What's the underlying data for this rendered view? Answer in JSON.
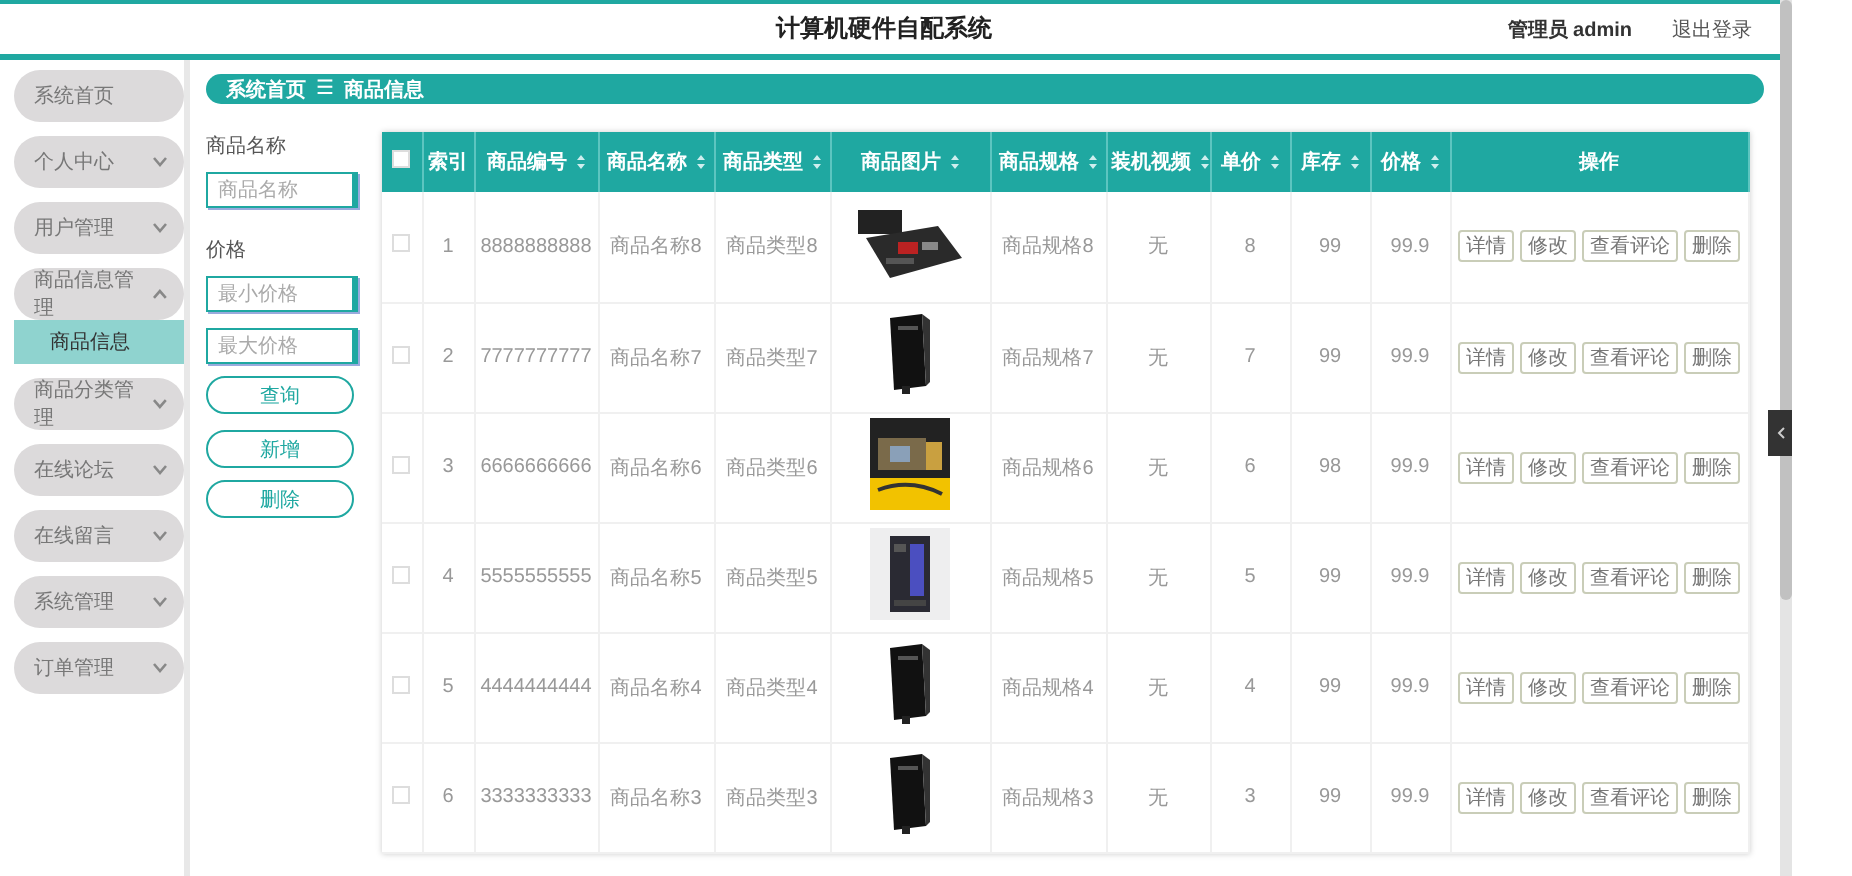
{
  "header": {
    "title": "计算机硬件自配系统",
    "user": "管理员 admin",
    "logout": "退出登录"
  },
  "sidebar": {
    "items": [
      {
        "label": "系统首页",
        "kind": "link"
      },
      {
        "label": "个人中心",
        "kind": "menu",
        "expanded": false
      },
      {
        "label": "用户管理",
        "kind": "menu",
        "expanded": false
      },
      {
        "label": "商品信息管理",
        "kind": "menu",
        "expanded": true,
        "children": [
          {
            "label": "商品信息",
            "selected": true
          }
        ]
      },
      {
        "label": "商品分类管理",
        "kind": "menu",
        "expanded": false
      },
      {
        "label": "在线论坛",
        "kind": "menu",
        "expanded": false
      },
      {
        "label": "在线留言",
        "kind": "menu",
        "expanded": false
      },
      {
        "label": "系统管理",
        "kind": "menu",
        "expanded": false
      },
      {
        "label": "订单管理",
        "kind": "menu",
        "expanded": false
      }
    ]
  },
  "breadcrumb": {
    "items": [
      "系统首页",
      "商品信息"
    ],
    "separator": "☰"
  },
  "search": {
    "name_label": "商品名称",
    "name_placeholder": "商品名称",
    "price_label": "价格",
    "min_placeholder": "最小价格",
    "max_placeholder": "最大价格",
    "buttons": [
      "查询",
      "新增",
      "删除"
    ]
  },
  "table": {
    "select_all": {
      "checked": false
    },
    "columns": [
      {
        "label": "索引",
        "sortable": false
      },
      {
        "label": "商品编号",
        "sortable": true
      },
      {
        "label": "商品名称",
        "sortable": true
      },
      {
        "label": "商品类型",
        "sortable": true
      },
      {
        "label": "商品图片",
        "sortable": true
      },
      {
        "label": "商品规格",
        "sortable": true
      },
      {
        "label": "装机视频",
        "sortable": true
      },
      {
        "label": "单价",
        "sortable": true
      },
      {
        "label": "库存",
        "sortable": true
      },
      {
        "label": "价格",
        "sortable": true
      },
      {
        "label": "操作",
        "sortable": false
      }
    ],
    "rows": [
      {
        "checked": false,
        "cells": [
          "1",
          "8888888888",
          "商品名称8",
          "商品类型8",
          "",
          "商品规格8",
          "无",
          "8",
          "99",
          "99.9"
        ],
        "actions": [
          "详情",
          "修改",
          "查看评论",
          "删除"
        ]
      },
      {
        "checked": false,
        "cells": [
          "2",
          "7777777777",
          "商品名称7",
          "商品类型7",
          "",
          "商品规格7",
          "无",
          "7",
          "99",
          "99.9"
        ],
        "actions": [
          "详情",
          "修改",
          "查看评论",
          "删除"
        ]
      },
      {
        "checked": false,
        "cells": [
          "3",
          "6666666666",
          "商品名称6",
          "商品类型6",
          "",
          "商品规格6",
          "无",
          "6",
          "98",
          "99.9"
        ],
        "actions": [
          "详情",
          "修改",
          "查看评论",
          "删除"
        ]
      },
      {
        "checked": false,
        "cells": [
          "4",
          "5555555555",
          "商品名称5",
          "商品类型5",
          "",
          "商品规格5",
          "无",
          "5",
          "99",
          "99.9"
        ],
        "actions": [
          "详情",
          "修改",
          "查看评论",
          "删除"
        ]
      },
      {
        "checked": false,
        "cells": [
          "5",
          "4444444444",
          "商品名称4",
          "商品类型4",
          "",
          "商品规格4",
          "无",
          "4",
          "99",
          "99.9"
        ],
        "actions": [
          "详情",
          "修改",
          "查看评论",
          "删除"
        ]
      },
      {
        "checked": false,
        "cells": [
          "6",
          "3333333333",
          "商品名称3",
          "商品类型3",
          "",
          "商品规格3",
          "无",
          "3",
          "99",
          "99.9"
        ],
        "actions": [
          "详情",
          "修改",
          "查看评论",
          "删除"
        ]
      }
    ]
  }
}
